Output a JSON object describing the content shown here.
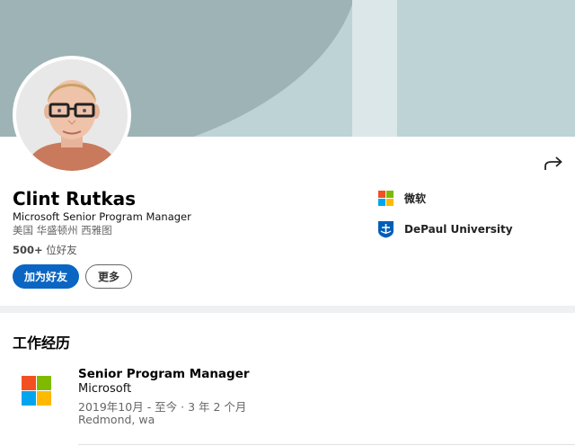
{
  "profile": {
    "name": "Clint Rutkas",
    "headline": "Microsoft Senior Program Manager",
    "location": "美国 华盛顿州 西雅图",
    "connections_count": "500+",
    "connections_suffix": " 位好友",
    "avatar_icon": "profile-photo"
  },
  "actions": {
    "primary_label": "加为好友",
    "secondary_label": "更多",
    "share_icon": "share-arrow-icon"
  },
  "orgs": [
    {
      "label": "微软",
      "icon": "microsoft-logo-icon"
    },
    {
      "label": "DePaul University",
      "icon": "depaul-logo-icon"
    }
  ],
  "experience": {
    "section_title": "工作经历",
    "items": [
      {
        "title": "Senior Program Manager",
        "company": "Microsoft",
        "dates": "2019年10月 - 至今 · 3 年 2 个月",
        "place": "Redmond, wa",
        "icon": "microsoft-logo-icon"
      }
    ]
  },
  "colors": {
    "primary": "#0a66c2",
    "banner": "#bed3d6",
    "banner_dark": "#9eb3b6",
    "ms_red": "#f25022",
    "ms_green": "#7fba00",
    "ms_blue": "#00a4ef",
    "ms_yellow": "#ffb900",
    "depaul_blue": "#005eb8"
  }
}
